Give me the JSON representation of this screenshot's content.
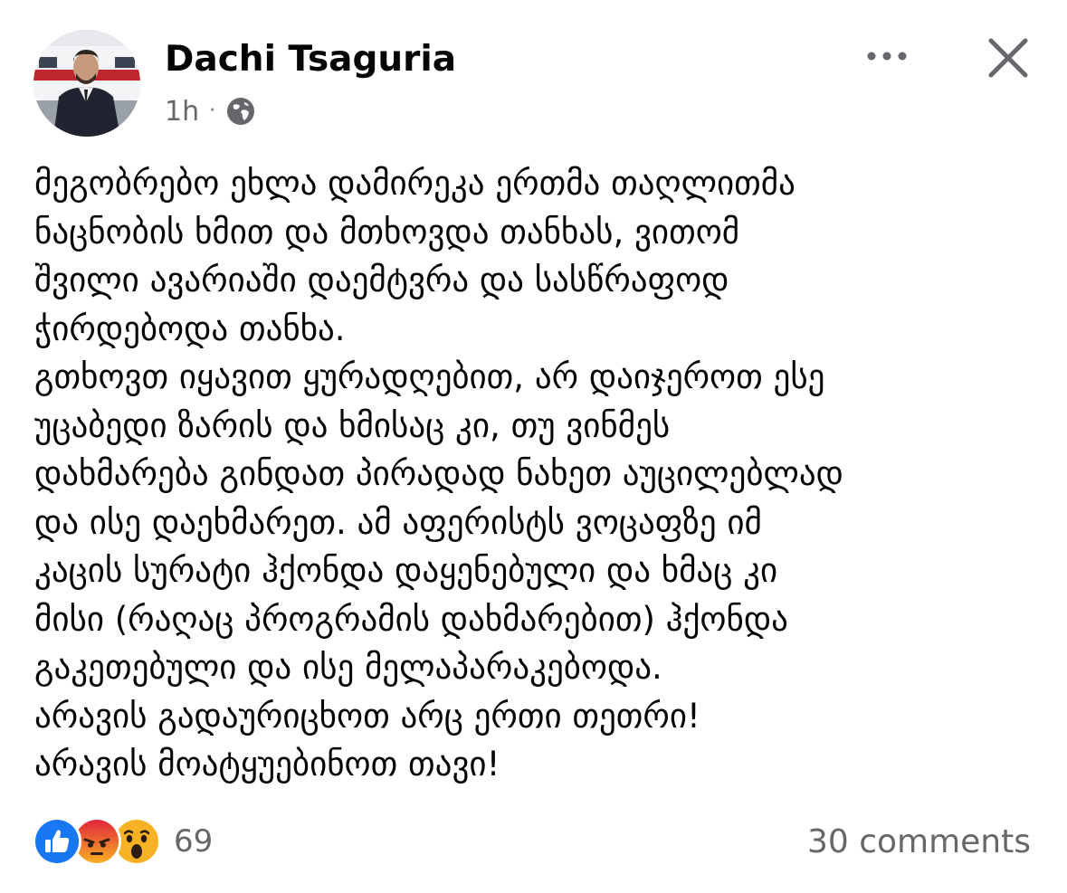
{
  "post": {
    "author": "Dachi Tsaguria",
    "time": "1h",
    "separator": "·",
    "privacy_icon": "globe-icon",
    "more_icon": "more-horizontal-icon",
    "close_icon": "close-icon",
    "text_lines": [
      "მეგობრებო ეხლა დამირეკა ერთმა თაღლითმა",
      "ნაცნობის ხმით და მთხოვდა თანხას, ვითომ",
      "შვილი ავარიაში დაემტვრა და სასწრაფოდ",
      "ჭირდებოდა თანხა.",
      "გთხოვთ იყავით ყურადღებით, არ დაიჯეროთ ესე",
      "უცაბედი ზარის და ხმისაც კი, თუ ვინმეს",
      "დახმარება გინდათ პირადად ნახეთ აუცილებლად",
      "და ისე დაეხმარეთ. ამ აფერისტს ვოცაფზე იმ",
      "კაცის სურატი ჰქონდა დაყენებული და ხმაც კი",
      "მისი (რაღაც პროგრამის დახმარებით) ჰქონდა",
      "გაკეთებული და ისე მელაპარაკებოდა.",
      "არავის გადაურიცხოთ არც ერთი თეთრი!",
      "არავის მოატყუებინოთ თავი!"
    ]
  },
  "footer": {
    "reactions": [
      "like-reaction-icon",
      "angry-reaction-icon",
      "wow-reaction-icon"
    ],
    "reaction_count": "69",
    "comments": "30 comments"
  },
  "colors": {
    "text": "#050505",
    "secondary": "#65676b",
    "like_blue": "#1877f2",
    "angry_red": "#e9710f",
    "wow_yellow": "#f7b125"
  }
}
